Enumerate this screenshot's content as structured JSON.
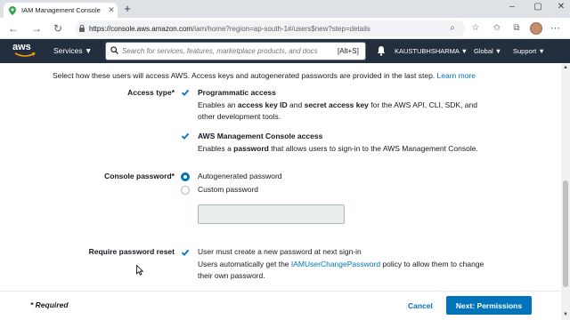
{
  "browser": {
    "tab_title": "IAM Management Console",
    "url_host": "https://console.aws.amazon.com",
    "url_path": "/iam/home?region=ap-south-1#/users$new?step=details"
  },
  "aws_header": {
    "services_label": "Services",
    "search_placeholder": "Search for services, features, marketplace products, and docs",
    "search_shortcut": "[Alt+S]",
    "account_label": "KAUSTUBHSHARMA",
    "region_label": "Global",
    "support_label": "Support"
  },
  "content": {
    "intro_text": "Select how these users will access AWS. Access keys and autogenerated passwords are provided in the last step.",
    "intro_link": "Learn more",
    "access_type": {
      "label": "Access type*",
      "programmatic": {
        "title": "Programmatic access",
        "desc_pre": "Enables an ",
        "desc_b1": "access key ID",
        "desc_mid": " and ",
        "desc_b2": "secret access key",
        "desc_post": " for the AWS API, CLI, SDK, and other development tools.",
        "checked": true
      },
      "console": {
        "title": "AWS Management Console access",
        "desc_pre": "Enables a ",
        "desc_b1": "password",
        "desc_post": " that allows users to sign-in to the AWS Management Console.",
        "checked": true
      }
    },
    "console_password": {
      "label": "Console password*",
      "option_auto": "Autogenerated password",
      "option_custom": "Custom password",
      "selected": "Autogenerated password"
    },
    "password_reset": {
      "label": "Require password reset",
      "title": "User must create a new password at next sign-in",
      "desc_pre": "Users automatically get the ",
      "desc_link": "IAMUserChangePassword",
      "desc_post": " policy to allow them to change their own password.",
      "checked": true
    }
  },
  "footer": {
    "required_note": "* Required",
    "cancel_label": "Cancel",
    "next_label": "Next: Permissions"
  },
  "colors": {
    "aws_header_bg": "#232f3e",
    "primary_blue": "#0073bb",
    "aws_orange": "#ff9900"
  }
}
